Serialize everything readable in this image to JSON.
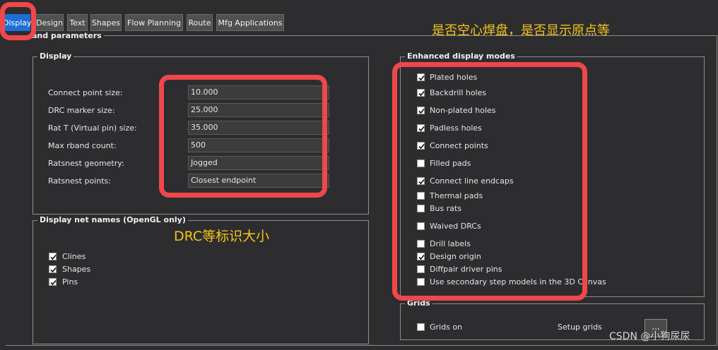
{
  "tabs": [
    "Display",
    "Design",
    "Text",
    "Shapes",
    "Flow Planning",
    "Route",
    "Mfg Applications"
  ],
  "section_title": "and parameters",
  "display_group": {
    "title": "Display",
    "rows": [
      {
        "label": "Connect point size:",
        "value": "10.000"
      },
      {
        "label": "DRC marker size:",
        "value": "25.000"
      },
      {
        "label": "Rat T (Virtual pin) size:",
        "value": "35.000"
      },
      {
        "label": "Max rband count:",
        "value": "500"
      },
      {
        "label": "Ratsnest geometry:",
        "value": "Jogged"
      },
      {
        "label": "Ratsnest points:",
        "value": "Closest endpoint"
      }
    ]
  },
  "net_names_group": {
    "title": "Display net names (OpenGL only)",
    "items": [
      {
        "label": "Clines",
        "checked": true
      },
      {
        "label": "Shapes",
        "checked": true
      },
      {
        "label": "Pins",
        "checked": true
      }
    ]
  },
  "enhanced_group": {
    "title": "Enhanced display modes",
    "items": [
      {
        "label": "Plated holes",
        "checked": true
      },
      {
        "label": "Backdrill holes",
        "checked": true
      },
      {
        "label": "Non-plated holes",
        "checked": true
      },
      {
        "label": "Padless holes",
        "checked": true
      },
      {
        "label": "Connect points",
        "checked": true
      },
      {
        "label": "Filled pads",
        "checked": false
      },
      {
        "label": "Connect line endcaps",
        "checked": true
      },
      {
        "label": "Thermal pads",
        "checked": false
      },
      {
        "label": "Bus rats",
        "checked": false
      },
      {
        "label": "Waived DRCs",
        "checked": false
      },
      {
        "label": "Drill labels",
        "checked": false
      },
      {
        "label": "Design origin",
        "checked": true
      },
      {
        "label": "Diffpair driver pins",
        "checked": false
      },
      {
        "label": "Use secondary step models in the 3D Canvas",
        "checked": false
      }
    ]
  },
  "grids_group": {
    "title": "Grids",
    "grids_on": {
      "label": "Grids on",
      "checked": false
    },
    "setup_label": "Setup grids",
    "more_button": "..."
  },
  "annotations": {
    "top_right": "是否空心焊盘，是否显示原点等",
    "middle_left": "DRC等标识大小"
  },
  "watermark": "CSDN @小狗尿尿",
  "colors": {
    "highlight_box": "#f0474a",
    "annotation_text": "#f5c518",
    "active_tab": "#1b6fd6"
  }
}
